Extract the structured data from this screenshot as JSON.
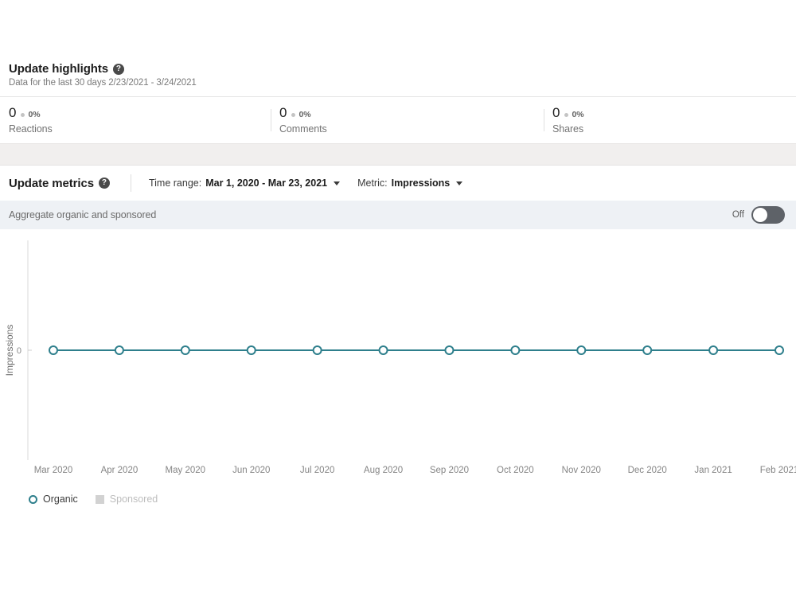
{
  "highlights": {
    "title": "Update highlights",
    "help_icon": "help-circle-icon",
    "subtitle": "Data for the last 30 days 2/23/2021 - 3/24/2021",
    "stats": [
      {
        "value": "0",
        "delta": "0%",
        "label": "Reactions"
      },
      {
        "value": "0",
        "delta": "0%",
        "label": "Comments"
      },
      {
        "value": "0",
        "delta": "0%",
        "label": "Shares"
      }
    ]
  },
  "metrics_toolbar": {
    "title": "Update metrics",
    "help_icon": "help-circle-icon",
    "time_range": {
      "label": "Time range:",
      "value": "Mar 1, 2020 - Mar 23, 2021",
      "caret_icon": "chevron-down-icon"
    },
    "metric": {
      "label": "Metric:",
      "value": "Impressions",
      "caret_icon": "chevron-down-icon"
    }
  },
  "aggregate": {
    "label": "Aggregate organic and sponsored",
    "state_label": "Off",
    "enabled": false
  },
  "colors": {
    "organic": "#2e7f8c",
    "sponsored": "#d2d2d2",
    "aggregate_bar_bg": "#eef1f5",
    "band_bg": "#f1efee",
    "toggle_track": "#5e6268"
  },
  "chart_data": {
    "type": "line",
    "title": "",
    "xlabel": "",
    "ylabel": "Impressions",
    "categories": [
      "Mar 2020",
      "Apr 2020",
      "May 2020",
      "Jun 2020",
      "Jul 2020",
      "Aug 2020",
      "Sep 2020",
      "Oct 2020",
      "Nov 2020",
      "Dec 2020",
      "Jan 2021",
      "Feb 2021"
    ],
    "ytick_labels": [
      "0"
    ],
    "ylim": [
      0,
      1
    ],
    "grid": false,
    "legend_position": "bottom-left",
    "series": [
      {
        "name": "Organic",
        "color": "#2e7f8c",
        "enabled": true,
        "marker": "circle",
        "values": [
          0,
          0,
          0,
          0,
          0,
          0,
          0,
          0,
          0,
          0,
          0,
          0
        ]
      },
      {
        "name": "Sponsored",
        "color": "#d2d2d2",
        "enabled": false,
        "marker": "square",
        "values": []
      }
    ]
  }
}
